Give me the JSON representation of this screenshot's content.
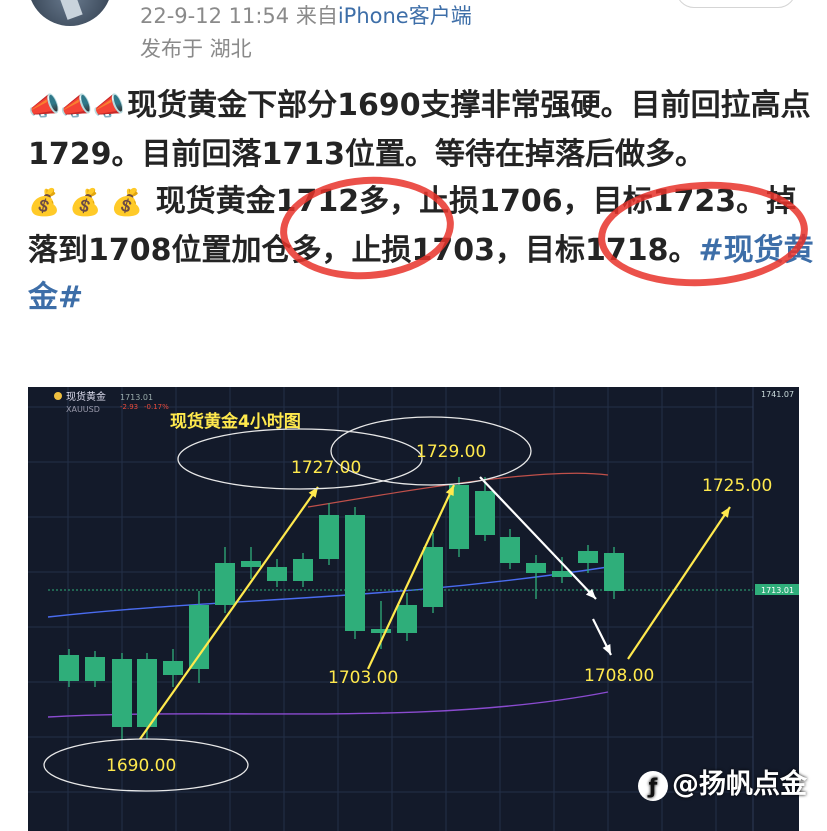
{
  "header": {
    "meta": "22-9-12 11:54",
    "from_prefix": "来自",
    "source": "iPhone客户端",
    "location": "发布于 湖北"
  },
  "post": {
    "line1_emoji": "📣📣📣",
    "para1": "现货黄金下部分1690支撑非常强硬。目前回拉高点1729。目前回落1713位置。等待在掉落后做多。",
    "line2_emoji": "💰 💰 💰",
    "para2": "现货黄金1712多，止损1706，目标1723。掉落到1708位置加仓多，止损1703，目标1718。",
    "hashtag": "#现货黄金#"
  },
  "chart": {
    "title": "现货黄金4小时图",
    "symbol": "现货黄金",
    "ticker": "XAUUSD",
    "last_price": "1713.01",
    "change": "-2.93",
    "change_pct": "-0.17%",
    "right_top_price": "1741.07",
    "labels": {
      "low": "1690.00",
      "high1": "1727.00",
      "high2": "1729.00",
      "pullback": "1703.00",
      "target_entry": "1708.00",
      "target": "1725.00"
    },
    "colors": {
      "up": "#e84a3c",
      "down": "#2fae7a",
      "arrow": "#ffe94d",
      "bg": "#131a2a"
    }
  },
  "watermark": "@扬帆点金",
  "chart_data": {
    "type": "candlestick",
    "title": "现货黄金4小时图",
    "annotations": [
      "1690.00",
      "1727.00",
      "1729.00",
      "1703.00",
      "1708.00",
      "1725.00"
    ]
  }
}
